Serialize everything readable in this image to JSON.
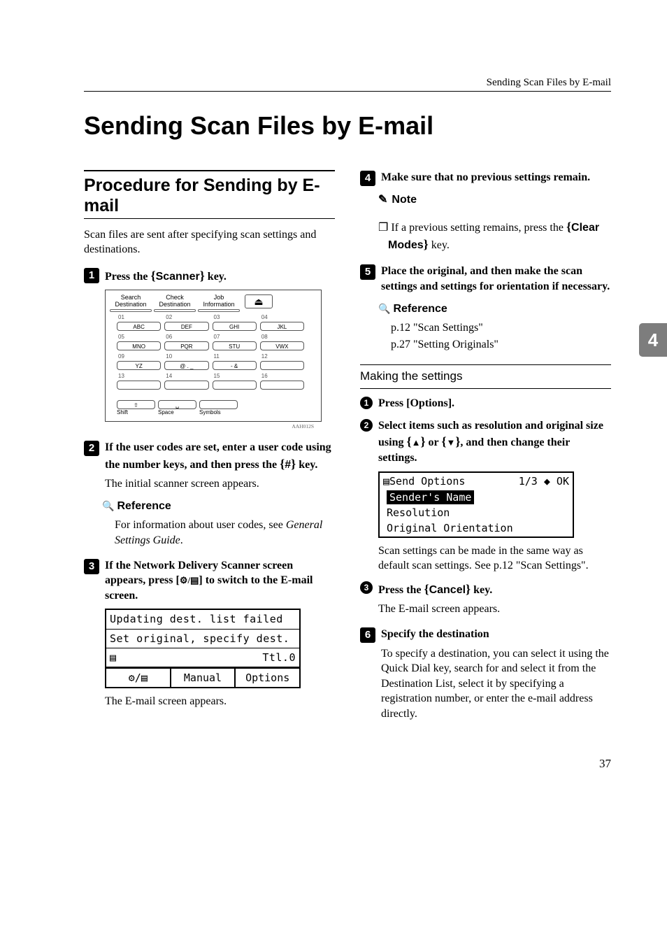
{
  "running_header": "Sending Scan Files by E-mail",
  "title": "Sending Scan Files by E-mail",
  "section_heading": "Procedure for Sending by E-mail",
  "intro": "Scan files are sent after specifying scan settings and destinations.",
  "steps": {
    "s1": {
      "num": "1",
      "text_a": "Press the ",
      "key": "Scanner",
      "text_b": " key."
    },
    "s2": {
      "num": "2",
      "text_a": "If the user codes are set, enter a user code using the number keys, and then press the ",
      "key": "#",
      "text_b": " key.",
      "after": "The initial scanner screen appears.",
      "ref_label": "Reference",
      "ref_body_a": "For information about user codes, see ",
      "ref_body_b": "General Settings Guide",
      "ref_body_c": "."
    },
    "s3": {
      "num": "3",
      "text": "If the Network Delivery Scanner screen appears, press [      ] to switch to the E-mail screen.",
      "after": "The E-mail screen appears."
    },
    "s4": {
      "num": "4",
      "text": "Make sure that no previous settings remain.",
      "note_label": "Note",
      "note_a": "If a previous setting remains, press the ",
      "note_key": "Clear Modes",
      "note_b": " key."
    },
    "s5": {
      "num": "5",
      "text": "Place the original, and then make the scan settings and settings for orientation if necessary.",
      "ref_label": "Reference",
      "ref1": "p.12 \"Scan Settings\"",
      "ref2": "p.27 \"Setting Originals\""
    },
    "s6": {
      "num": "6",
      "text": "Specify the destination",
      "after": "To specify a destination, you can select it using the Quick Dial key, search for and select it from the Destination List, select it by specifying a registration number, or enter the e-mail address directly."
    }
  },
  "making_settings_label": "Making the settings",
  "substeps": {
    "a": {
      "num": "1",
      "text": "Press [Options]."
    },
    "b": {
      "num": "2",
      "text_a": "Select items such as resolution and original size using ",
      "arrow_up": "▲",
      "text_mid": " or ",
      "arrow_down": "▼",
      "text_b": ", and then change their settings.",
      "after": "Scan settings can be made in the same way as default scan settings. See p.12 \"Scan Settings\"."
    },
    "c": {
      "num": "3",
      "text_a": "Press the ",
      "key": "Cancel",
      "text_b": " key.",
      "after": "The E-mail screen appears."
    }
  },
  "keypad": {
    "top": [
      "Search Destination",
      "Check Destination",
      "Job Information"
    ],
    "eject": "⏏",
    "rows": [
      [
        {
          "n": "01",
          "k": "ABC"
        },
        {
          "n": "02",
          "k": "DEF"
        },
        {
          "n": "03",
          "k": "GHI"
        },
        {
          "n": "04",
          "k": "JKL"
        }
      ],
      [
        {
          "n": "05",
          "k": "MNO"
        },
        {
          "n": "06",
          "k": "PQR"
        },
        {
          "n": "07",
          "k": "STU"
        },
        {
          "n": "08",
          "k": "VWX"
        }
      ],
      [
        {
          "n": "09",
          "k": "YZ"
        },
        {
          "n": "10",
          "k": "@ . _"
        },
        {
          "n": "11",
          "k": "- &"
        },
        {
          "n": "12",
          "k": ""
        }
      ],
      [
        {
          "n": "13",
          "k": ""
        },
        {
          "n": "14",
          "k": ""
        },
        {
          "n": "15",
          "k": ""
        },
        {
          "n": "16",
          "k": ""
        }
      ]
    ],
    "bottom": [
      {
        "icon": "⇧",
        "label": "Shift"
      },
      {
        "icon": "␣",
        "label": "Space"
      },
      {
        "icon": "",
        "label": "Symbols"
      }
    ],
    "caption": "AAH012S"
  },
  "lcd1": {
    "line1": "Updating dest. list failed",
    "line2": "Set original, specify dest.",
    "line3_left": "▤",
    "line3_right": "Ttl.0",
    "soft": [
      "⚙/▤",
      "Manual",
      "Options"
    ]
  },
  "lcd2": {
    "head_left": "▤Send Options",
    "head_right": "1/3  ◆ OK",
    "item1": "Sender's Name",
    "item2": "Resolution",
    "item3": "Original Orientation"
  },
  "chapter_number": "4",
  "page_number": "37"
}
